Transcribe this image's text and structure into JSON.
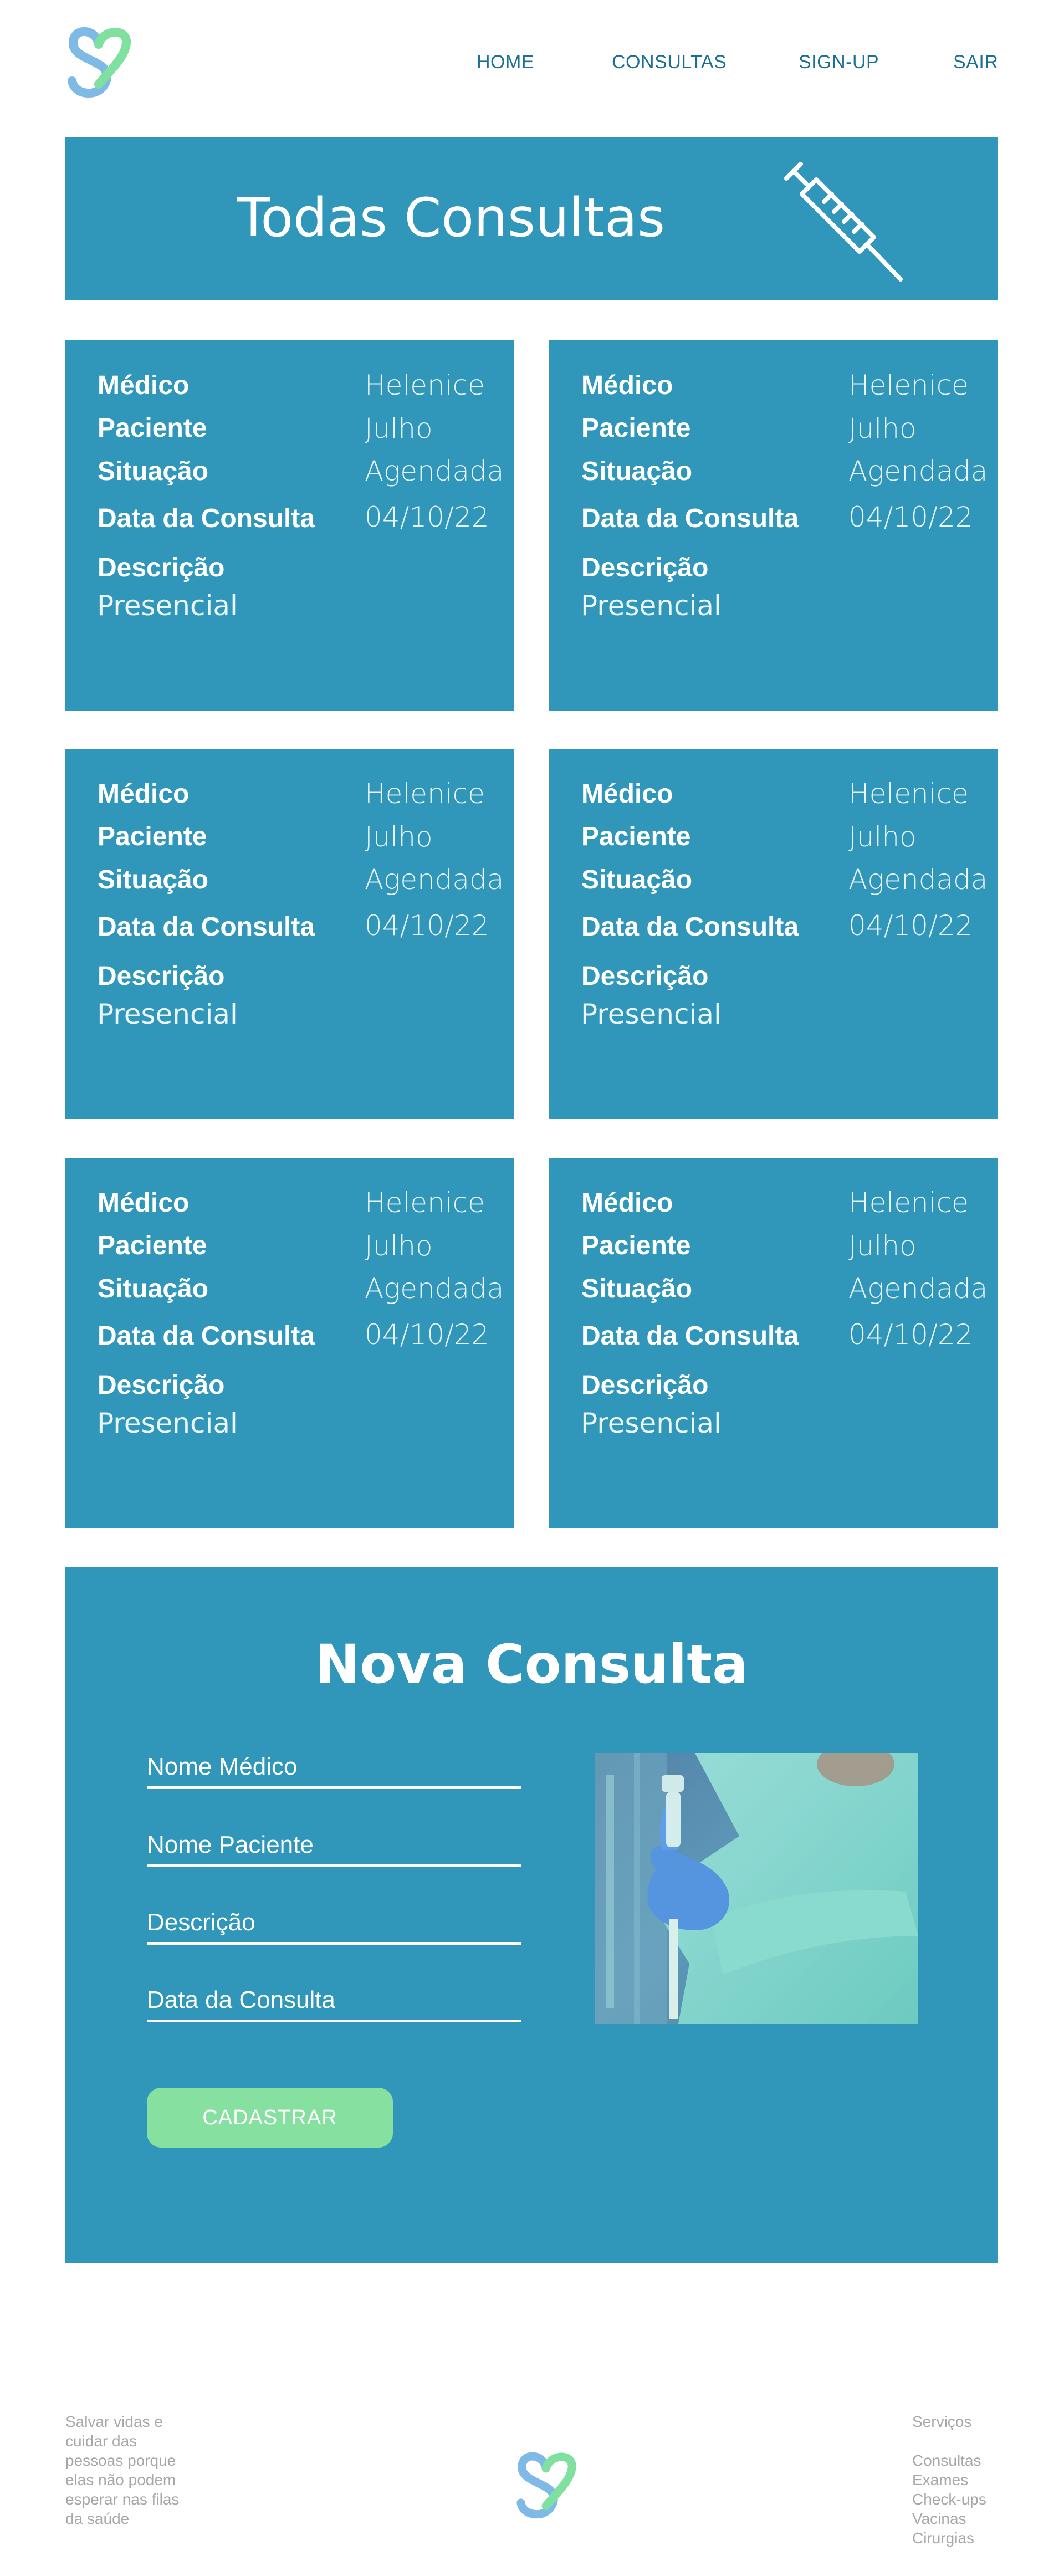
{
  "nav": {
    "home": "HOME",
    "consultas": "CONSULTAS",
    "signup": "SIGN-UP",
    "sair": "SAIR"
  },
  "banner": {
    "title": "Todas Consultas"
  },
  "labels": {
    "medico": "Médico",
    "paciente": "Paciente",
    "situacao": "Situação",
    "data": "Data da Consulta",
    "descricao": "Descrição"
  },
  "consultas": [
    {
      "medico": "Helenice",
      "paciente": "Julho",
      "situacao": "Agendada",
      "data": "04/10/22",
      "descricao": "Presencial"
    },
    {
      "medico": "Helenice",
      "paciente": "Julho",
      "situacao": "Agendada",
      "data": "04/10/22",
      "descricao": "Presencial"
    },
    {
      "medico": "Helenice",
      "paciente": "Julho",
      "situacao": "Agendada",
      "data": "04/10/22",
      "descricao": "Presencial"
    },
    {
      "medico": "Helenice",
      "paciente": "Julho",
      "situacao": "Agendada",
      "data": "04/10/22",
      "descricao": "Presencial"
    },
    {
      "medico": "Helenice",
      "paciente": "Julho",
      "situacao": "Agendada",
      "data": "04/10/22",
      "descricao": "Presencial"
    },
    {
      "medico": "Helenice",
      "paciente": "Julho",
      "situacao": "Agendada",
      "data": "04/10/22",
      "descricao": "Presencial"
    }
  ],
  "form": {
    "title": "Nova Consulta",
    "nome_medico_placeholder": "Nome Médico",
    "nome_paciente_placeholder": "Nome Paciente",
    "descricao_placeholder": "Descrição",
    "data_placeholder": "Data da Consulta",
    "submit_label": "CADASTRAR"
  },
  "footer": {
    "tagline": "Salvar vidas e cuidar das pessoas porque elas não podem esperar nas filas da saúde",
    "services_heading": "Serviços",
    "services": [
      "Consultas",
      "Exames",
      "Check-ups",
      "Vacinas",
      "Cirurgias"
    ]
  },
  "colors": {
    "primary": "#3097ba",
    "nav_text": "#1b6f94",
    "accent_green": "#86e0a0",
    "footer_text": "#a7a7a7",
    "logo_blue": "#7fb9e6",
    "logo_green": "#7fe0a0"
  },
  "icons": {
    "logo": "heart-s-logo-icon",
    "banner": "syringe-icon"
  }
}
